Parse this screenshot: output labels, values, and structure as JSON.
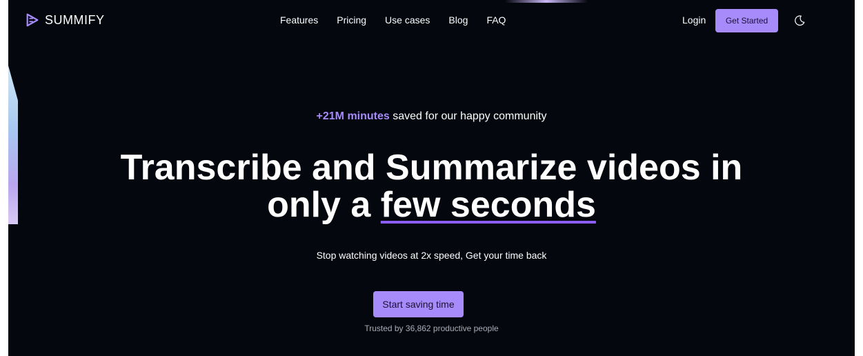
{
  "brand": {
    "name": "SUMMIFY",
    "accent_color": "#a78bfa",
    "icon": "play-stack-icon"
  },
  "nav": {
    "links": [
      "Features",
      "Pricing",
      "Use cases",
      "Blog",
      "FAQ"
    ],
    "login_label": "Login",
    "get_started_label": "Get Started",
    "theme_toggle_icon": "moon-icon"
  },
  "hero": {
    "kicker_accent": "+21M minutes",
    "kicker_rest": " saved for our happy community",
    "headline_line1": "Transcribe and Summarize videos in",
    "headline_prefix": "only a ",
    "headline_underlined": "few seconds",
    "subtext": "Stop watching videos at 2x speed, Get your time back",
    "cta_label": "Start saving time",
    "trusted_text": "Trusted by 36,862 productive people"
  },
  "colors": {
    "background": "#05070f",
    "text": "#ffffff",
    "underline": "#8b5cf6"
  }
}
